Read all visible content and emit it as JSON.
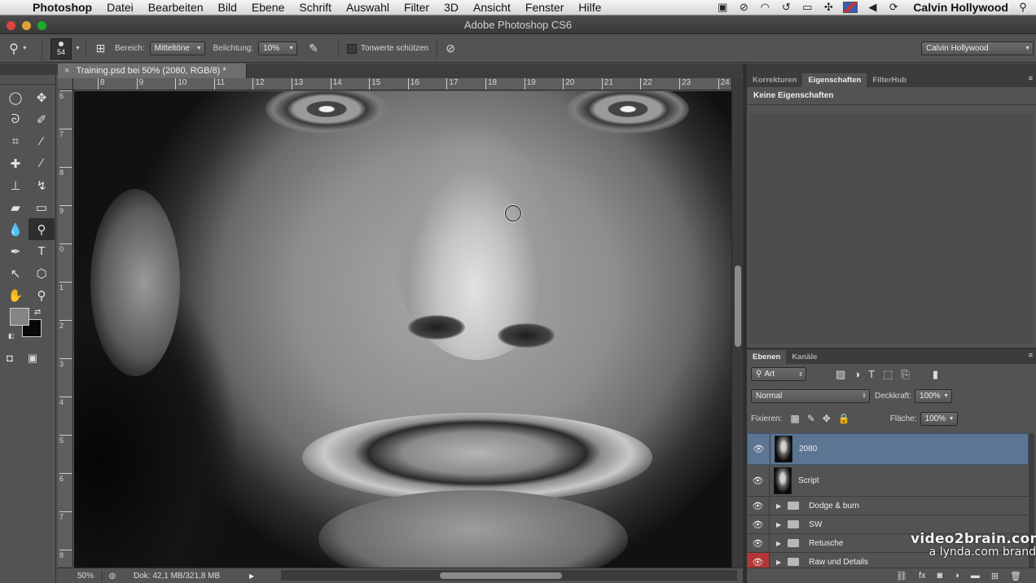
{
  "menubar": {
    "app_name": "Photoshop",
    "items": [
      "Datei",
      "Bearbeiten",
      "Bild",
      "Ebene",
      "Schrift",
      "Auswahl",
      "Filter",
      "3D",
      "Ansicht",
      "Fenster",
      "Hilfe"
    ],
    "user": "Calvin  Hollywood"
  },
  "window": {
    "title": "Adobe Photoshop CS6"
  },
  "options": {
    "brush_size": "54",
    "bereich_label": "Bereich:",
    "bereich_value": "Mitteltöne",
    "belichtung_label": "Belichtung:",
    "belichtung_value": "10%",
    "tonwerte_label": "Tonwerte schützen",
    "workspace": "Calvin Hollywood"
  },
  "document": {
    "tab_title": "Training.psd bei 50% (2080, RGB/8) *",
    "ruler_h": [
      "8",
      "9",
      "10",
      "11",
      "12",
      "13",
      "14",
      "15",
      "16",
      "17",
      "18",
      "19",
      "20",
      "21",
      "22",
      "23",
      "24"
    ],
    "ruler_v": [
      "6",
      "7",
      "8",
      "9",
      "0",
      "1",
      "2",
      "3",
      "4",
      "5",
      "6",
      "7",
      "8"
    ],
    "zoom": "50%",
    "doc_info": "Dok: 42,1 MB/321,8 MB"
  },
  "properties_panel": {
    "tabs": [
      "Korrekturen",
      "Eigenschaften",
      "FilterHub"
    ],
    "active_tab": "Eigenschaften",
    "empty_label": "Keine Eigenschaften"
  },
  "layers_panel": {
    "tabs": [
      "Ebenen",
      "Kanäle"
    ],
    "filter_label": "Art",
    "blend_mode": "Normal",
    "opacity_label": "Deckkraft:",
    "opacity_value": "100%",
    "lock_label": "Fixieren:",
    "fill_label": "Fläche:",
    "fill_value": "100%",
    "layers": [
      {
        "name": "2080",
        "type": "image",
        "selected": true
      },
      {
        "name": "Script",
        "type": "smart"
      },
      {
        "name": "Dodge & burn",
        "type": "group"
      },
      {
        "name": "SW",
        "type": "group"
      },
      {
        "name": "Retusche",
        "type": "group"
      },
      {
        "name": "Raw und Details",
        "type": "group"
      }
    ]
  },
  "watermark": {
    "line1": "video2brain.com",
    "line2": "a lynda.com brand"
  },
  "colors": {
    "foreground": "#858585",
    "background": "#080808",
    "selected_layer": "#5c7593"
  }
}
